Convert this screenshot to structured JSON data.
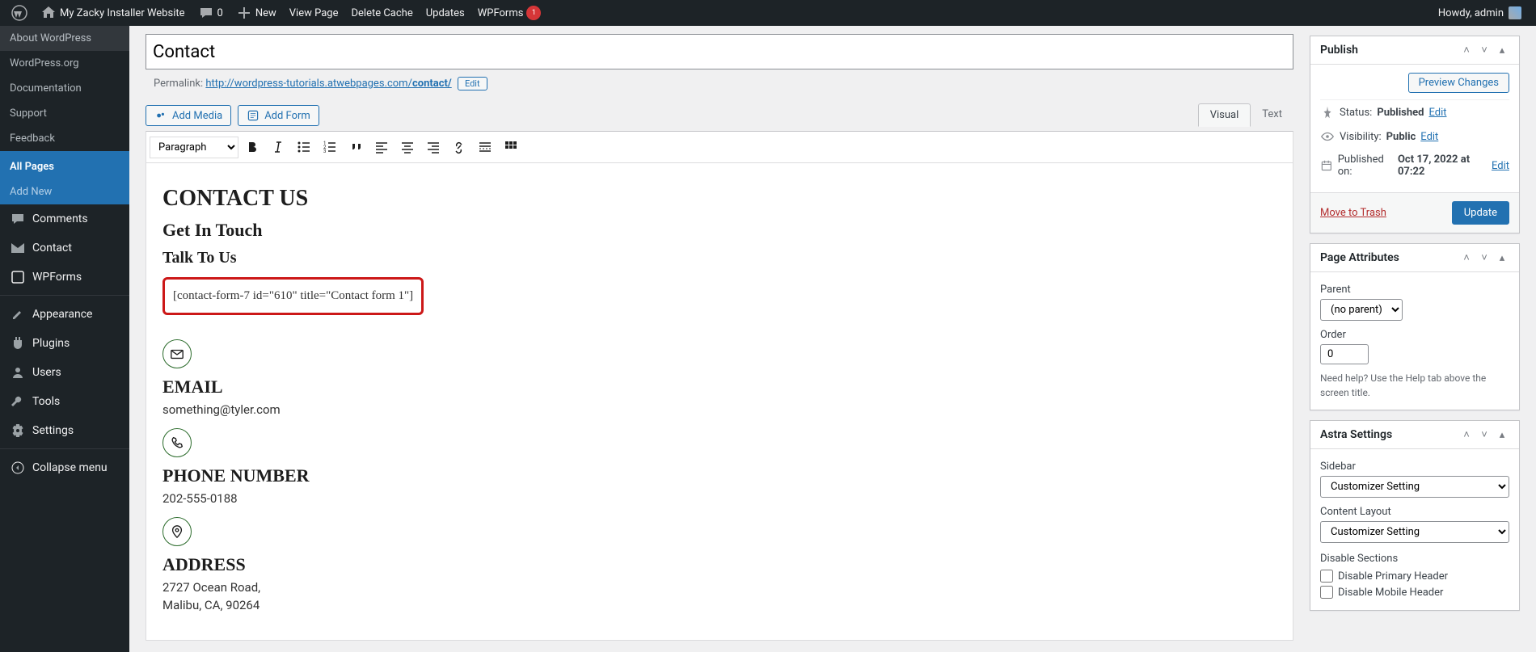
{
  "adminbar": {
    "site_name": "My Zacky Installer Website",
    "comments_count": "0",
    "new_label": "New",
    "view_page": "View Page",
    "delete_cache": "Delete Cache",
    "updates": "Updates",
    "wpforms": "WPForms",
    "wpforms_badge": "1",
    "howdy": "Howdy, admin"
  },
  "sidebar": {
    "about": "About WordPress",
    "wporg": "WordPress.org",
    "docs": "Documentation",
    "support": "Support",
    "feedback": "Feedback",
    "all_pages": "All Pages",
    "add_new": "Add New",
    "comments": "Comments",
    "contact": "Contact",
    "wpforms": "WPForms",
    "appearance": "Appearance",
    "plugins": "Plugins",
    "users": "Users",
    "tools": "Tools",
    "settings": "Settings",
    "collapse": "Collapse menu"
  },
  "page": {
    "title": "Contact",
    "permalink_label": "Permalink:",
    "permalink_base": "http://wordpress-tutorials.atwebpages.com/",
    "permalink_slug": "contact/",
    "edit_btn": "Edit",
    "add_media": "Add Media",
    "add_form": "Add Form",
    "tab_visual": "Visual",
    "tab_text": "Text",
    "format_select": "Paragraph"
  },
  "content": {
    "h_contact_us": "CONTACT US",
    "h_get_in_touch": "Get In Touch",
    "h_talk_to_us": "Talk To Us",
    "shortcode": "[contact-form-7 id=\"610\" title=\"Contact form 1\"]",
    "h_email": "EMAIL",
    "email_val": "something@tyler.com",
    "h_phone": "PHONE NUMBER",
    "phone_val": "202-555-0188",
    "h_address": "ADDRESS",
    "addr_line1": "2727 Ocean Road,",
    "addr_line2": "Malibu, CA, 90264"
  },
  "publish": {
    "title": "Publish",
    "preview": "Preview Changes",
    "status_label": "Status:",
    "status_val": "Published",
    "visibility_label": "Visibility:",
    "visibility_val": "Public",
    "published_on_label": "Published on:",
    "published_on_val": "Oct 17, 2022 at 07:22",
    "edit": "Edit",
    "trash": "Move to Trash",
    "update": "Update"
  },
  "page_attributes": {
    "title": "Page Attributes",
    "parent_label": "Parent",
    "parent_val": "(no parent)",
    "order_label": "Order",
    "order_val": "0",
    "help": "Need help? Use the Help tab above the screen title."
  },
  "astra": {
    "title": "Astra Settings",
    "sidebar_label": "Sidebar",
    "sidebar_val": "Customizer Setting",
    "content_layout_label": "Content Layout",
    "content_layout_val": "Customizer Setting",
    "disable_sections": "Disable Sections",
    "disable_primary_header": "Disable Primary Header",
    "disable_mobile_header": "Disable Mobile Header"
  }
}
